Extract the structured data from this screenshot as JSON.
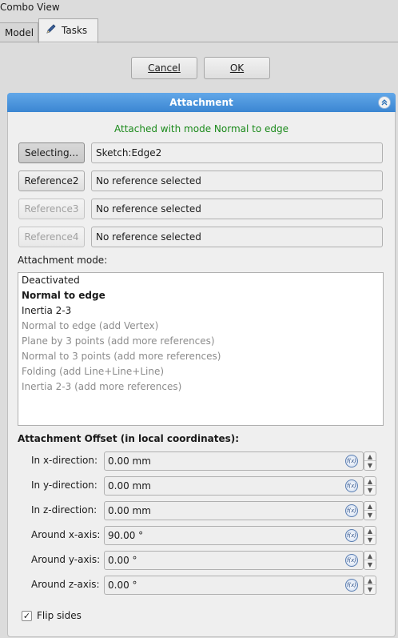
{
  "window_title": "Combo View",
  "tabs": [
    {
      "label": "Model"
    },
    {
      "label": "Tasks"
    }
  ],
  "dialog_buttons": {
    "cancel_label": "Cancel",
    "ok_label": "OK"
  },
  "attachment": {
    "header": "Attachment",
    "status": "Attached with mode Normal to edge",
    "references": [
      {
        "button": "Selecting...",
        "value": "Sketch:Edge2",
        "state": "active"
      },
      {
        "button": "Reference2",
        "value": "No reference selected",
        "state": "enabled"
      },
      {
        "button": "Reference3",
        "value": "No reference selected",
        "state": "disabled"
      },
      {
        "button": "Reference4",
        "value": "No reference selected",
        "state": "disabled"
      }
    ],
    "mode_label": "Attachment mode:",
    "modes": [
      {
        "label": "Deactivated",
        "style": "normal"
      },
      {
        "label": "Normal to edge",
        "style": "bold"
      },
      {
        "label": "Inertia 2-3",
        "style": "normal"
      },
      {
        "label": "Normal to edge (add Vertex)",
        "style": "gray"
      },
      {
        "label": "Plane by 3 points (add more references)",
        "style": "gray"
      },
      {
        "label": "Normal to 3 points (add more references)",
        "style": "gray"
      },
      {
        "label": "Folding (add Line+Line+Line)",
        "style": "gray"
      },
      {
        "label": "Inertia 2-3 (add more references)",
        "style": "gray"
      }
    ],
    "offset_title": "Attachment Offset (in local coordinates):",
    "offsets": [
      {
        "label": "In x-direction:",
        "value": "0.00 mm"
      },
      {
        "label": "In y-direction:",
        "value": "0.00 mm"
      },
      {
        "label": "In z-direction:",
        "value": "0.00 mm"
      },
      {
        "label": "Around x-axis:",
        "value": "90.00 °"
      },
      {
        "label": "Around y-axis:",
        "value": "0.00 °"
      },
      {
        "label": "Around z-axis:",
        "value": "0.00 °"
      }
    ],
    "flip_sides_label": "Flip sides",
    "flip_sides_checked": true
  },
  "icons": {
    "tasks_tab": "pencil-icon",
    "collapse": "double-chevron-up-icon",
    "expression": "fx-expression-icon",
    "check": "checkmark-icon"
  },
  "colors": {
    "header_blue": "#3b86d2",
    "status_green": "#1b8a1b",
    "disabled_text": "#8c8c8c"
  }
}
